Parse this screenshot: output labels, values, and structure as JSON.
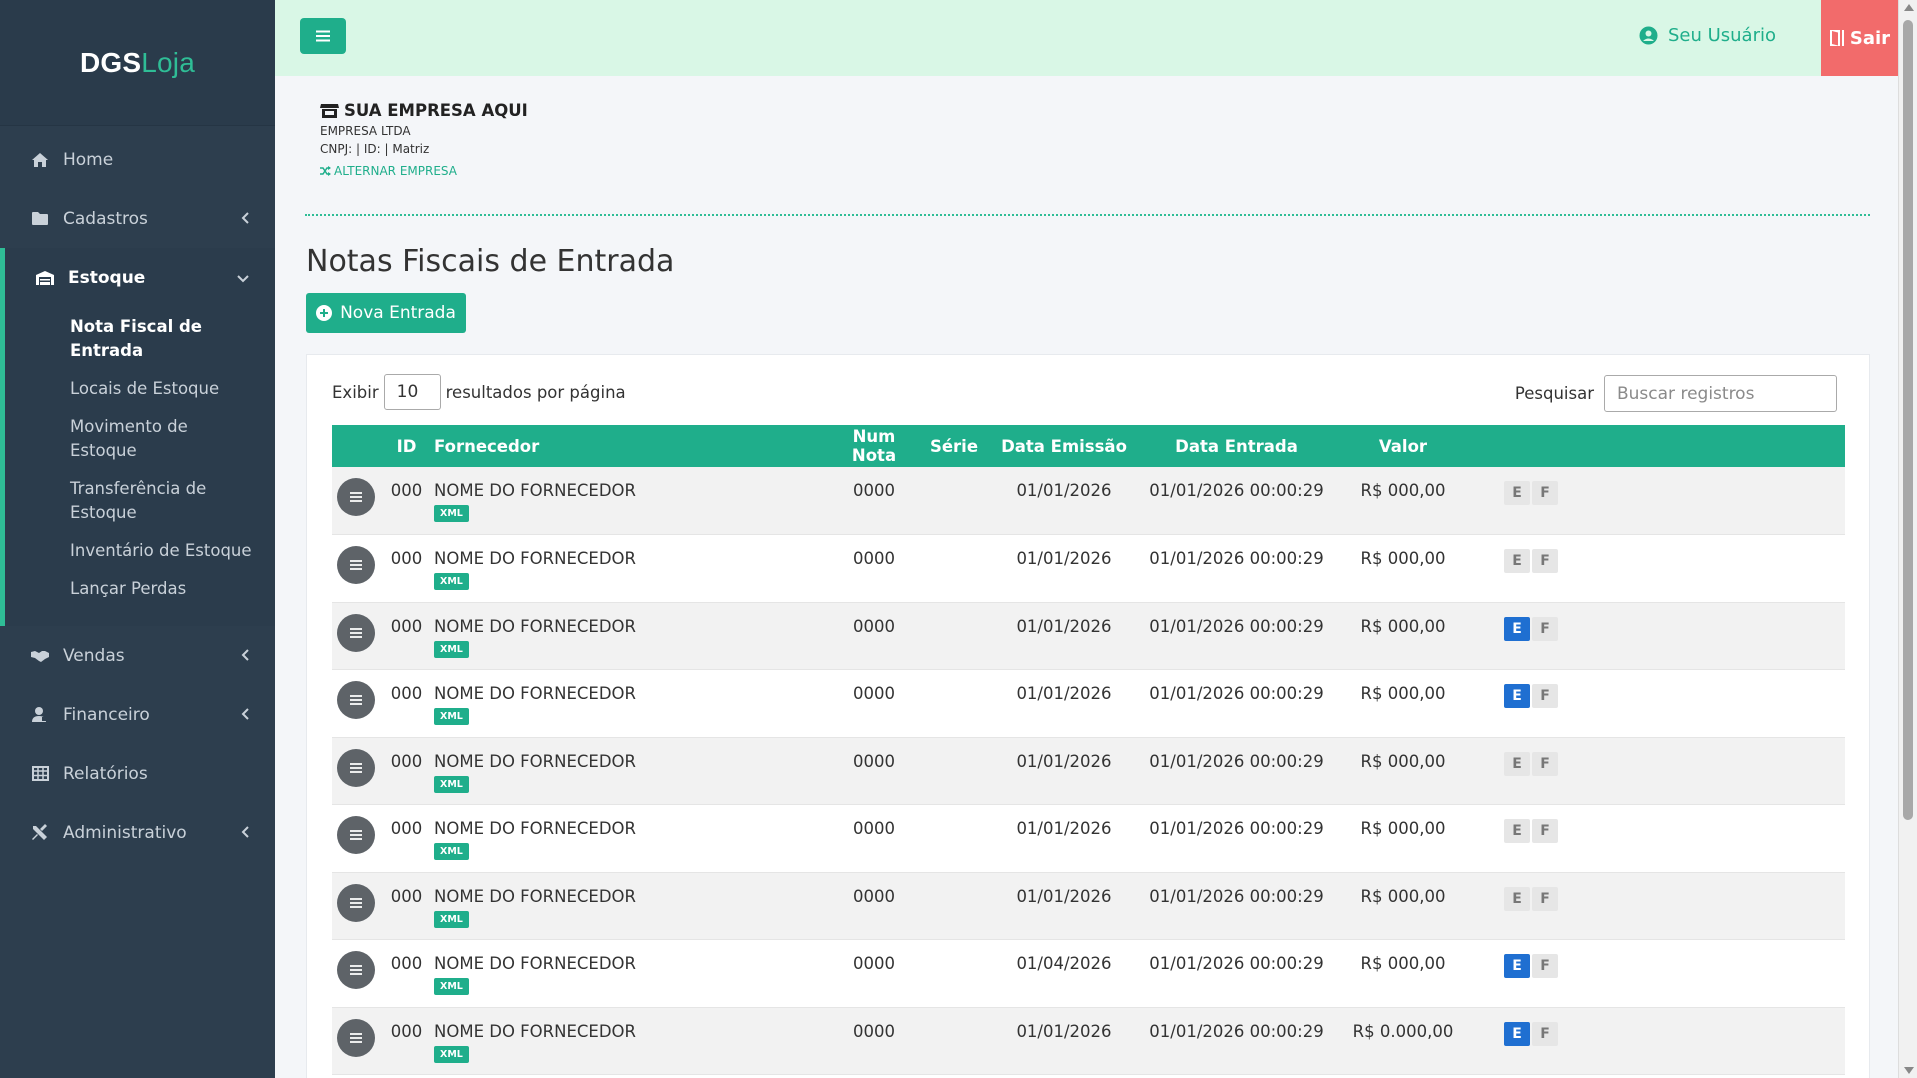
{
  "brand": {
    "part1": "DGS",
    "part2": "Loja"
  },
  "sidebar": {
    "items_top": [
      {
        "label": "Home",
        "icon": "home-icon"
      },
      {
        "label": "Cadastros",
        "icon": "folder-icon"
      }
    ],
    "group": {
      "label": "Estoque",
      "icon": "warehouse-icon",
      "sub": [
        "Nota Fiscal de Entrada",
        "Locais de Estoque",
        "Movimento de Estoque",
        "Transferência de Estoque",
        "Inventário de Estoque",
        "Lançar Perdas"
      ]
    },
    "items_bottom": [
      {
        "label": "Vendas",
        "icon": "handshake-icon"
      },
      {
        "label": "Financeiro",
        "icon": "user-money-icon"
      },
      {
        "label": "Relatórios",
        "icon": "table-icon"
      },
      {
        "label": "Administrativo",
        "icon": "tools-icon"
      }
    ]
  },
  "topbar": {
    "user_label": "Seu Usuário",
    "logout_label": "Sair"
  },
  "company": {
    "name": "SUA EMPRESA AQUI",
    "legal_name": "EMPRESA LTDA",
    "cnpj_line": "CNPJ: | ID: | Matriz",
    "switch_label": "ALTERNAR EMPRESA"
  },
  "page": {
    "title": "Notas Fiscais de Entrada",
    "new_button": "Nova Entrada"
  },
  "table_controls": {
    "show_label": "Exibir",
    "page_length": "10",
    "per_page_label": "resultados por página",
    "search_label": "Pesquisar",
    "search_placeholder": "Buscar registros"
  },
  "table": {
    "headers": [
      "",
      "ID",
      "Fornecedor",
      "Num Nota",
      "Série",
      "Data Emissão",
      "Data Entrada",
      "Valor",
      ""
    ],
    "rows": [
      {
        "id": "000",
        "supplier": "NOME DO FORNECEDOR",
        "badge": "XML",
        "num": "0000",
        "serie": "",
        "emission": "01/01/2026",
        "entry": "01/01/2026 00:00:29",
        "value": "R$ 000,00",
        "e": "E",
        "f": "F",
        "e_active": false
      },
      {
        "id": "000",
        "supplier": "NOME DO FORNECEDOR",
        "badge": "XML",
        "num": "0000",
        "serie": "",
        "emission": "01/01/2026",
        "entry": "01/01/2026 00:00:29",
        "value": "R$ 000,00",
        "e": "E",
        "f": "F",
        "e_active": false
      },
      {
        "id": "000",
        "supplier": "NOME DO FORNECEDOR",
        "badge": "XML",
        "num": "0000",
        "serie": "",
        "emission": "01/01/2026",
        "entry": "01/01/2026 00:00:29",
        "value": "R$ 000,00",
        "e": "E",
        "f": "F",
        "e_active": true
      },
      {
        "id": "000",
        "supplier": "NOME DO FORNECEDOR",
        "badge": "XML",
        "num": "0000",
        "serie": "",
        "emission": "01/01/2026",
        "entry": "01/01/2026 00:00:29",
        "value": "R$ 000,00",
        "e": "E",
        "f": "F",
        "e_active": true
      },
      {
        "id": "000",
        "supplier": "NOME DO FORNECEDOR",
        "badge": "XML",
        "num": "0000",
        "serie": "",
        "emission": "01/01/2026",
        "entry": "01/01/2026 00:00:29",
        "value": "R$ 000,00",
        "e": "E",
        "f": "F",
        "e_active": false
      },
      {
        "id": "000",
        "supplier": "NOME DO FORNECEDOR",
        "badge": "XML",
        "num": "0000",
        "serie": "",
        "emission": "01/01/2026",
        "entry": "01/01/2026 00:00:29",
        "value": "R$ 000,00",
        "e": "E",
        "f": "F",
        "e_active": false
      },
      {
        "id": "000",
        "supplier": "NOME DO FORNECEDOR",
        "badge": "XML",
        "num": "0000",
        "serie": "",
        "emission": "01/01/2026",
        "entry": "01/01/2026 00:00:29",
        "value": "R$ 000,00",
        "e": "E",
        "f": "F",
        "e_active": false
      },
      {
        "id": "000",
        "supplier": "NOME DO FORNECEDOR",
        "badge": "XML",
        "num": "0000",
        "serie": "",
        "emission": "01/04/2026",
        "entry": "01/01/2026 00:00:29",
        "value": "R$ 000,00",
        "e": "E",
        "f": "F",
        "e_active": true
      },
      {
        "id": "000",
        "supplier": "NOME DO FORNECEDOR",
        "badge": "XML",
        "num": "0000",
        "serie": "",
        "emission": "01/01/2026",
        "entry": "01/01/2026 00:00:29",
        "value": "R$ 0.000,00",
        "e": "E",
        "f": "F",
        "e_active": true
      }
    ]
  },
  "colors": {
    "accent": "#1fae8b",
    "sidebar": "#2d3e4e",
    "topbar": "#d9f7e6",
    "logout": "#f26b6b",
    "active_action": "#1f6fd1"
  }
}
